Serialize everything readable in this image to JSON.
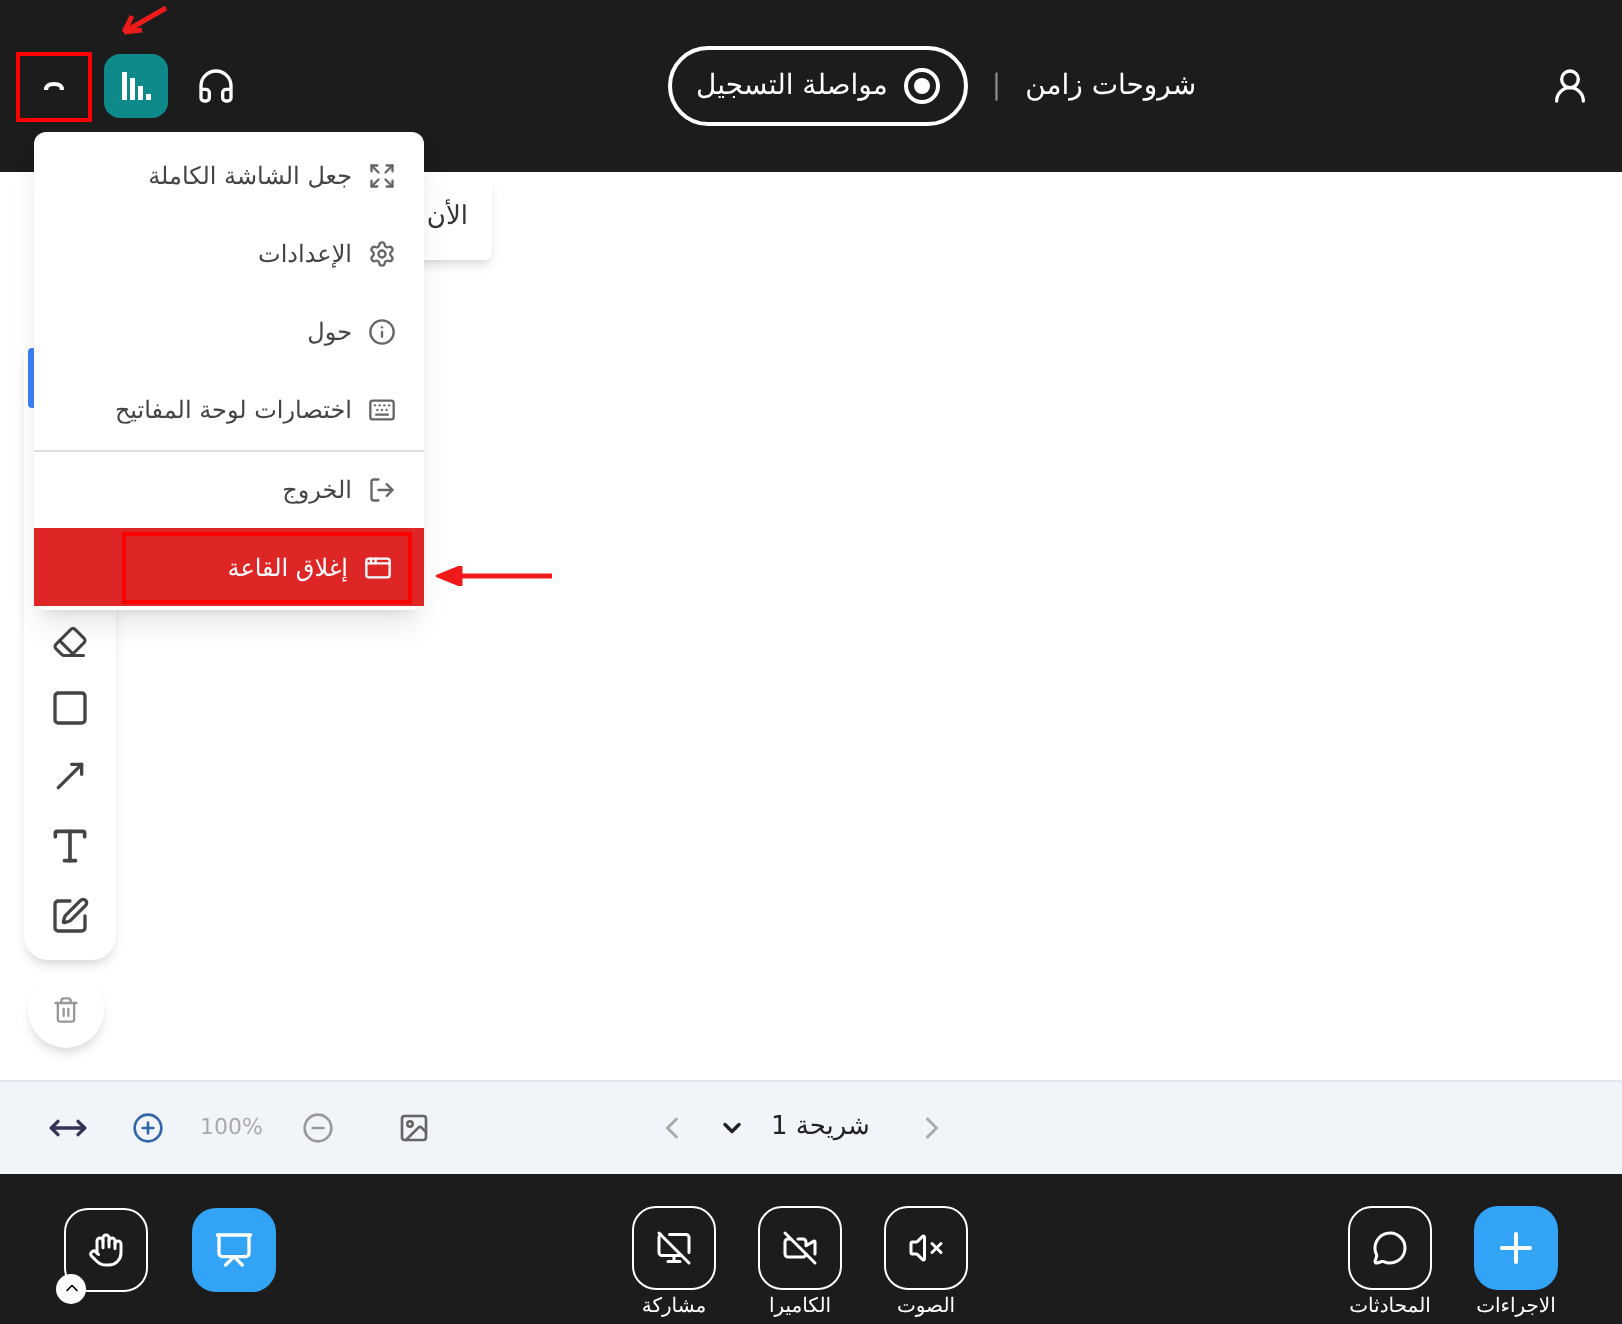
{
  "top_bar": {
    "title": "شروحات زامن",
    "separator": "|",
    "record_button": "مواصلة التسجيل"
  },
  "menu": {
    "items": [
      {
        "kind": "fullscreen",
        "label": "جعل الشاشة الكاملة",
        "danger": false,
        "divider_before": false
      },
      {
        "kind": "settings",
        "label": "الإعدادات",
        "danger": false,
        "divider_before": false
      },
      {
        "kind": "about",
        "label": "حول",
        "danger": false,
        "divider_before": false
      },
      {
        "kind": "shortcuts",
        "label": "اختصارات لوحة المفاتيح",
        "danger": false,
        "divider_before": false
      },
      {
        "kind": "exit",
        "label": "الخروج",
        "danger": false,
        "divider_before": true
      },
      {
        "kind": "close",
        "label": "إغلاق القاعة",
        "danger": true,
        "divider_before": false
      }
    ]
  },
  "popup_peek": "الأن",
  "slide_bar": {
    "zoom": "100%",
    "slide": "شريحة 1"
  },
  "bottom_bar": {
    "presenter_selected": true,
    "media": [
      {
        "kind": "audio",
        "label": "الصوت"
      },
      {
        "kind": "camera",
        "label": "الكاميرا"
      },
      {
        "kind": "share",
        "label": "مشاركة"
      }
    ],
    "chats": "المحادثات",
    "actions": "الاجراءات"
  }
}
